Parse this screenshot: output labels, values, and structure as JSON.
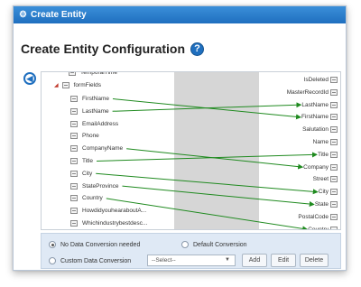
{
  "window": {
    "title": "Create Entity"
  },
  "heading": "Create Entity Configuration",
  "help_glyph": "?",
  "left_fields": {
    "temporal": "TemporalTime",
    "group": "formFields",
    "items": [
      "FirstName",
      "LastName",
      "EmailAddress",
      "Phone",
      "CompanyName",
      "Title",
      "City",
      "StateProvince",
      "Country",
      "HowdidyouhearaboutA...",
      "Whichindustrybestdesc..."
    ]
  },
  "right_fields": [
    "IsDeleted",
    "MasterRecordId",
    "LastName",
    "FirstName",
    "Salutation",
    "Name",
    "Title",
    "Company",
    "Street",
    "City",
    "State",
    "PostalCode",
    "Country"
  ],
  "mappings": [
    {
      "from": "FirstName",
      "to": "FirstName"
    },
    {
      "from": "LastName",
      "to": "LastName"
    },
    {
      "from": "CompanyName",
      "to": "Company"
    },
    {
      "from": "Title",
      "to": "Title"
    },
    {
      "from": "City",
      "to": "City"
    },
    {
      "from": "StateProvince",
      "to": "State"
    },
    {
      "from": "Country",
      "to": "Country"
    }
  ],
  "mapping_color": "#1f8a1f",
  "conversion": {
    "none_label": "No Data Conversion needed",
    "default_label": "Default Conversion",
    "custom_label": "Custom Data Conversion",
    "select_value": "--Select--",
    "selected": "none"
  },
  "buttons": {
    "add": "Add",
    "edit": "Edit",
    "delete": "Delete"
  },
  "icons": {
    "title": "gear-icon",
    "help": "help-icon",
    "back": "arrow-left-circle-icon"
  }
}
